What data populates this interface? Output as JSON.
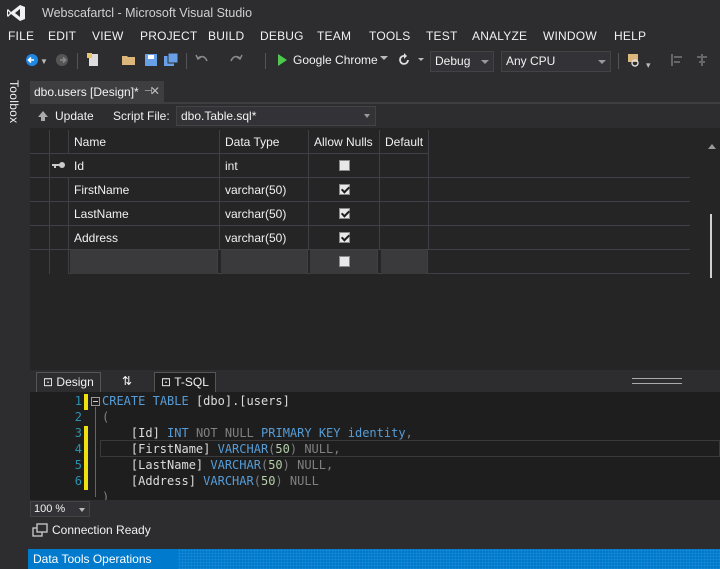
{
  "window": {
    "title": "Webscafartcl - Microsoft Visual Studio"
  },
  "menu": [
    "FILE",
    "EDIT",
    "VIEW",
    "PROJECT",
    "BUILD",
    "DEBUG",
    "TEAM",
    "TOOLS",
    "TEST",
    "ANALYZE",
    "WINDOW",
    "HELP"
  ],
  "toolbar": {
    "browser": "Google Chrome",
    "configuration": "Debug",
    "platform": "Any CPU"
  },
  "toolbox": {
    "label": "Toolbox"
  },
  "document_tab": {
    "label": "dbo.users [Design]*"
  },
  "designer": {
    "update_label": "Update",
    "script_file_label": "Script File:",
    "script_file_value": "dbo.Table.sql*",
    "columns": [
      "Name",
      "Data Type",
      "Allow Nulls",
      "Default"
    ],
    "rows": [
      {
        "name": "Id",
        "type": "int",
        "allow_nulls": false,
        "primary_key": true
      },
      {
        "name": "FirstName",
        "type": "varchar(50)",
        "allow_nulls": true,
        "primary_key": false
      },
      {
        "name": "LastName",
        "type": "varchar(50)",
        "allow_nulls": true,
        "primary_key": false
      },
      {
        "name": "Address",
        "type": "varchar(50)",
        "allow_nulls": true,
        "primary_key": false
      }
    ]
  },
  "panes": {
    "design": "Design",
    "swap": "⇅",
    "tsql": "T-SQL"
  },
  "editor": {
    "line_numbers": [
      "1",
      "2",
      "3",
      "4",
      "5",
      "6"
    ],
    "lines": [
      "CREATE TABLE [dbo].[users]",
      "(",
      "    [Id] INT NOT NULL PRIMARY KEY identity,",
      "    [FirstName] VARCHAR(50) NULL,",
      "    [LastName] VARCHAR(50) NULL,",
      "    [Address] VARCHAR(50) NULL",
      ")"
    ]
  },
  "zoom": {
    "value": "100 %"
  },
  "connection": {
    "status": "Connection Ready"
  },
  "statusbar": {
    "text": "Data Tools Operations"
  }
}
